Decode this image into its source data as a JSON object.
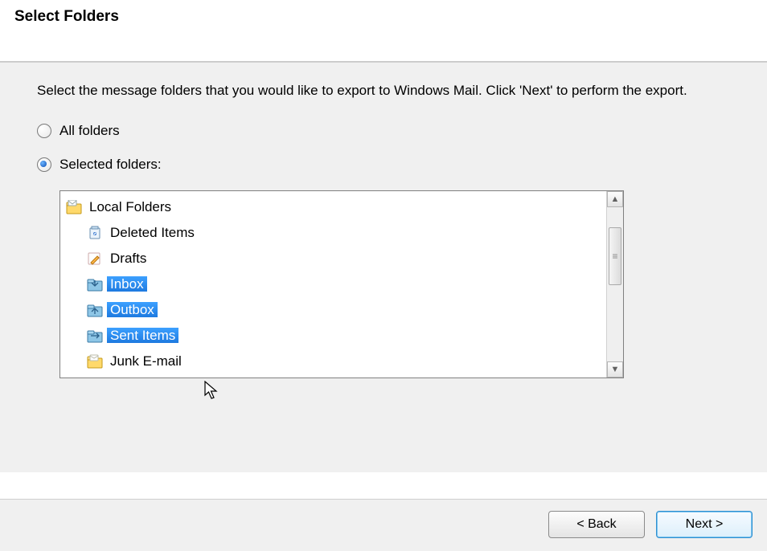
{
  "header": {
    "title": "Select Folders"
  },
  "body": {
    "instruction": "Select the message folders that you would like to export to Windows Mail. Click 'Next' to perform the export.",
    "options": {
      "all": "All folders",
      "selected": "Selected folders:",
      "checked": "selected"
    }
  },
  "tree": {
    "root": {
      "label": "Local Folders",
      "icon": "local-folders-icon",
      "selected": false,
      "children": [
        {
          "label": "Deleted Items",
          "icon": "trash-icon",
          "selected": false
        },
        {
          "label": "Drafts",
          "icon": "drafts-icon",
          "selected": false
        },
        {
          "label": "Inbox",
          "icon": "inbox-icon",
          "selected": true
        },
        {
          "label": "Outbox",
          "icon": "outbox-icon",
          "selected": true
        },
        {
          "label": "Sent Items",
          "icon": "sent-icon",
          "selected": true
        },
        {
          "label": "Junk E-mail",
          "icon": "junk-icon",
          "selected": false
        }
      ]
    }
  },
  "footer": {
    "back": "< Back",
    "next": "Next >"
  }
}
